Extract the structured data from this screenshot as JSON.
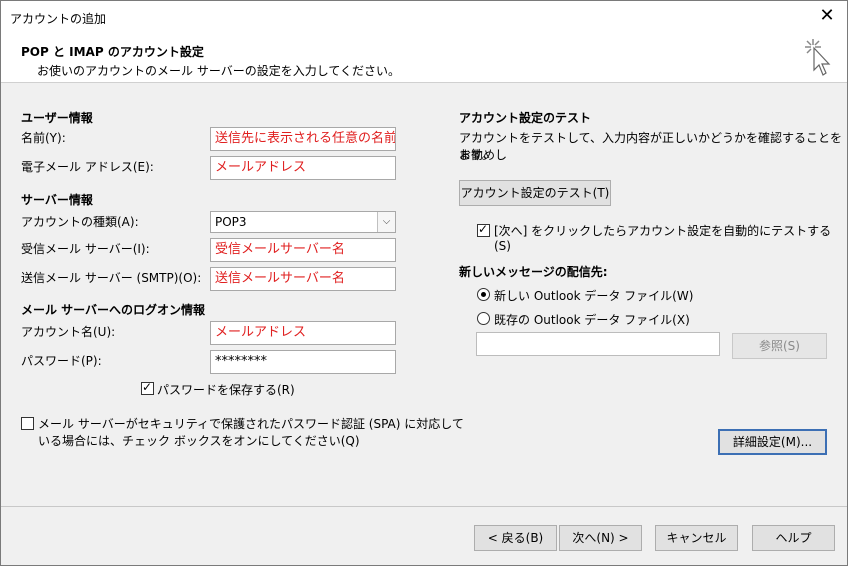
{
  "window": {
    "title": "アカウントの追加",
    "close_icon": "close-icon"
  },
  "header": {
    "title": "POP と IMAP のアカウント設定",
    "subtitle": "お使いのアカウントのメール サーバーの設定を入力してください。"
  },
  "user_info": {
    "section": "ユーザー情報",
    "name_label": "名前(Y):",
    "name_value": "送信先に表示される任意の名前",
    "email_label": "電子メール アドレス(E):",
    "email_value": "メールアドレス"
  },
  "server_info": {
    "section": "サーバー情報",
    "account_type_label": "アカウントの種類(A):",
    "account_type_value": "POP3",
    "incoming_label": "受信メール サーバー(I):",
    "incoming_value": "受信メールサーバー名",
    "outgoing_label": "送信メール サーバー (SMTP)(O):",
    "outgoing_value": "送信メールサーバー名"
  },
  "logon_info": {
    "section": "メール サーバーへのログオン情報",
    "account_name_label": "アカウント名(U):",
    "account_name_value": "メールアドレス",
    "password_label": "パスワード(P):",
    "password_value": "********",
    "save_password_label": "パスワードを保存する(R)",
    "spa_line1": "メール サーバーがセキュリティで保護されたパスワード認証 (SPA) に対応して",
    "spa_line2": "いる場合には、チェック ボックスをオンにしてください(Q)"
  },
  "test": {
    "section": "アカウント設定のテスト",
    "desc_line1": "アカウントをテストして、入力内容が正しいかどうかを確認することをお勧めし",
    "desc_line2": "ます。",
    "test_button": "アカウント設定のテスト(T)",
    "auto_test_line1": "[次へ] をクリックしたらアカウント設定を自動的にテストする",
    "auto_test_line2": "(S)"
  },
  "delivery": {
    "section": "新しいメッセージの配信先:",
    "new_file_label": "新しい Outlook データ ファイル(W)",
    "existing_file_label": "既存の Outlook データ ファイル(X)",
    "browse_button": "参照(S)",
    "more_settings_button": "詳細設定(M)..."
  },
  "footer": {
    "back": "< 戻る(B)",
    "next": "次へ(N) >",
    "cancel": "キャンセル",
    "help": "ヘルプ"
  }
}
